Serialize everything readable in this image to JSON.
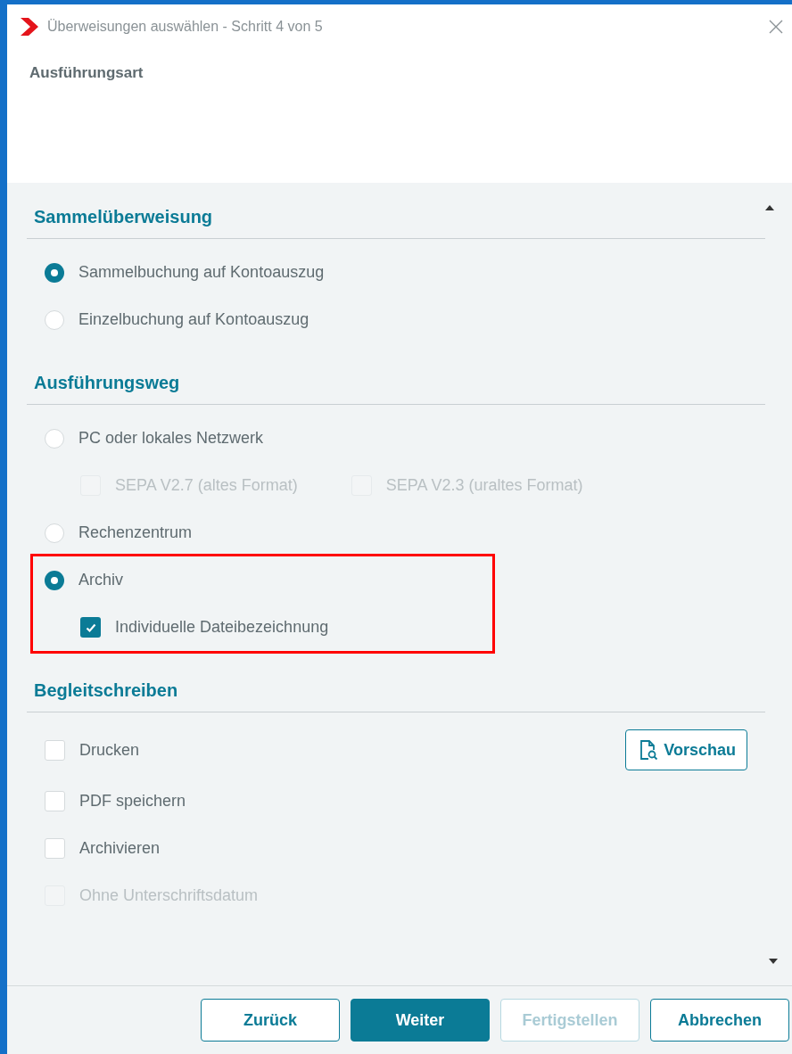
{
  "window": {
    "title": "Überweisungen auswählen - Schritt 4 von 5"
  },
  "step_title": "Ausführungsart",
  "sections": [
    {
      "heading": "Sammelüberweisung",
      "items": [
        {
          "kind": "radio",
          "label": "Sammelbuchung auf Kontoauszug",
          "selected": true,
          "disabled": false
        },
        {
          "kind": "radio",
          "label": "Einzelbuchung auf Kontoauszug",
          "selected": false,
          "disabled": false
        }
      ]
    },
    {
      "heading": "Ausführungsweg",
      "items": [
        {
          "kind": "radio",
          "label": "PC oder lokales Netzwerk",
          "selected": false,
          "disabled": false,
          "highlighted": false,
          "children": [
            {
              "kind": "checkbox",
              "label": "SEPA V2.7 (altes Format)",
              "checked": false,
              "disabled": true
            },
            {
              "kind": "checkbox",
              "label": "SEPA V2.3 (uraltes Format)",
              "checked": false,
              "disabled": true
            }
          ]
        },
        {
          "kind": "radio",
          "label": "Rechenzentrum",
          "selected": false,
          "disabled": false,
          "highlighted": false
        },
        {
          "kind": "radio",
          "label": "Archiv",
          "selected": true,
          "disabled": false,
          "highlighted": true,
          "children": [
            {
              "kind": "checkbox",
              "label": "Individuelle Dateibezeichnung",
              "checked": true,
              "disabled": false
            }
          ]
        }
      ]
    },
    {
      "heading": "Begleitschreiben",
      "items": [
        {
          "kind": "checkbox",
          "label": "Drucken",
          "checked": false,
          "disabled": false,
          "action": "Vorschau"
        },
        {
          "kind": "checkbox",
          "label": "PDF speichern",
          "checked": false,
          "disabled": false
        },
        {
          "kind": "checkbox",
          "label": "Archivieren",
          "checked": false,
          "disabled": false
        },
        {
          "kind": "checkbox",
          "label": "Ohne Unterschriftsdatum",
          "checked": false,
          "disabled": true
        }
      ]
    }
  ],
  "buttons": [
    {
      "label": "Zurück",
      "kind": "secondary",
      "disabled": false
    },
    {
      "label": "Weiter",
      "kind": "primary",
      "disabled": false
    },
    {
      "label": "Fertigstellen",
      "kind": "secondary",
      "disabled": true
    },
    {
      "label": "Abbrechen",
      "kind": "secondary",
      "disabled": false
    }
  ]
}
